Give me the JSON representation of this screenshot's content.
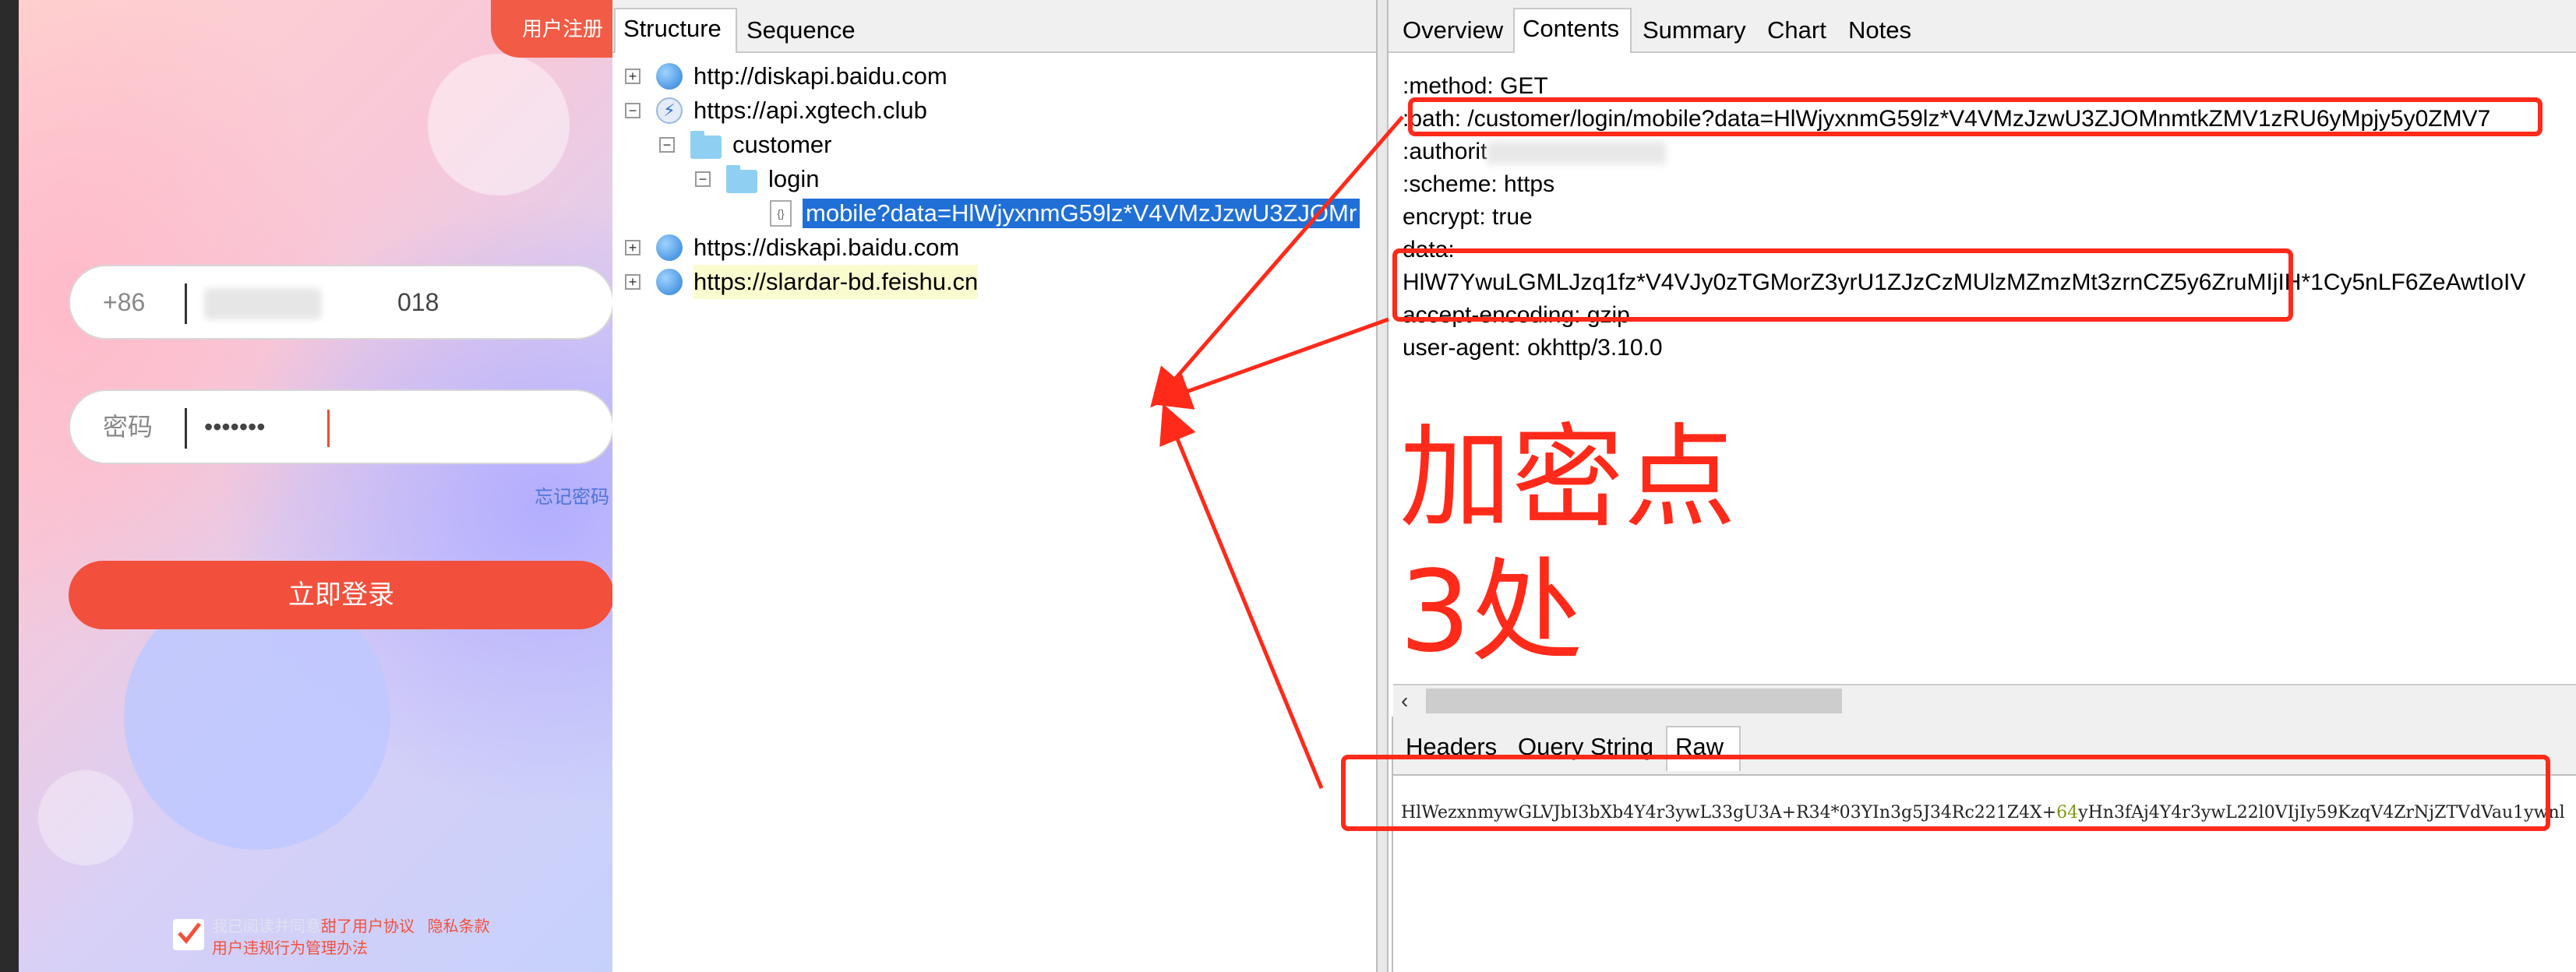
{
  "phone": {
    "register_btn": "用户注册",
    "phone_prefix": "+86",
    "phone_suffix": "018",
    "password_label": "密码",
    "password_value": "•••••••",
    "forgot": "忘记密码",
    "login_btn": "立即登录",
    "agree": {
      "prefix": "我已阅读并同意",
      "user_agreement": "甜了用户协议",
      "privacy": "隐私条款",
      "rules": "用户违规行为管理办法"
    }
  },
  "left_tabs": [
    "Structure",
    "Sequence"
  ],
  "tree": {
    "host1": "http://diskapi.baidu.com",
    "host2": "https://api.xgtech.club",
    "folder_customer": "customer",
    "folder_login": "login",
    "selected": "mobile?data=HlWjyxnmG59lz*V4VMzJzwU3ZJOMr",
    "host3": "https://diskapi.baidu.com",
    "host4": "https://slardar-bd.feishu.cn"
  },
  "right_tabs": [
    "Overview",
    "Contents",
    "Summary",
    "Chart",
    "Notes"
  ],
  "content_lines": {
    "method": ":method: GET",
    "path": ":path: /customer/login/mobile?data=HlWjyxnmG59lz*V4VMzJzwU3ZJOMnmtkZMV1zRU6yMpjy5y0ZMV7",
    "authority": ":authorit",
    "scheme": ":scheme: https",
    "encrypt": "encrypt: true",
    "data_key": "data:",
    "data_value": "HlW7YwuLGMLJzq1fz*V4VJy0zTGMorZ3yrU1ZJzCzMUlzMZmzMt3zrnCZ5y6ZruMIjIH*1Cy5nLF6ZeAwtIoIV",
    "accept": "accept-encoding: gzip",
    "ua": "user-agent: okhttp/3.10.0"
  },
  "bottom_tabs": [
    "Headers",
    "Query String",
    "Raw"
  ],
  "raw_line": {
    "a": "HlWezxnmywGLVJbI3bXb4Y4r3ywL33gU3A+R34*03YIn3g5J34Rc221Z4X+",
    "b": "64",
    "c": "yHn3fAj4Y4r3ywL22l0VIjIy59KzqV4ZrNjZTVdVau1ywnl"
  },
  "annotation": {
    "line1": "加密点",
    "line2": "3处"
  },
  "colors": {
    "accent": "#f2503c",
    "selection": "#1f6fd6",
    "annotation": "#ff2a1a"
  }
}
